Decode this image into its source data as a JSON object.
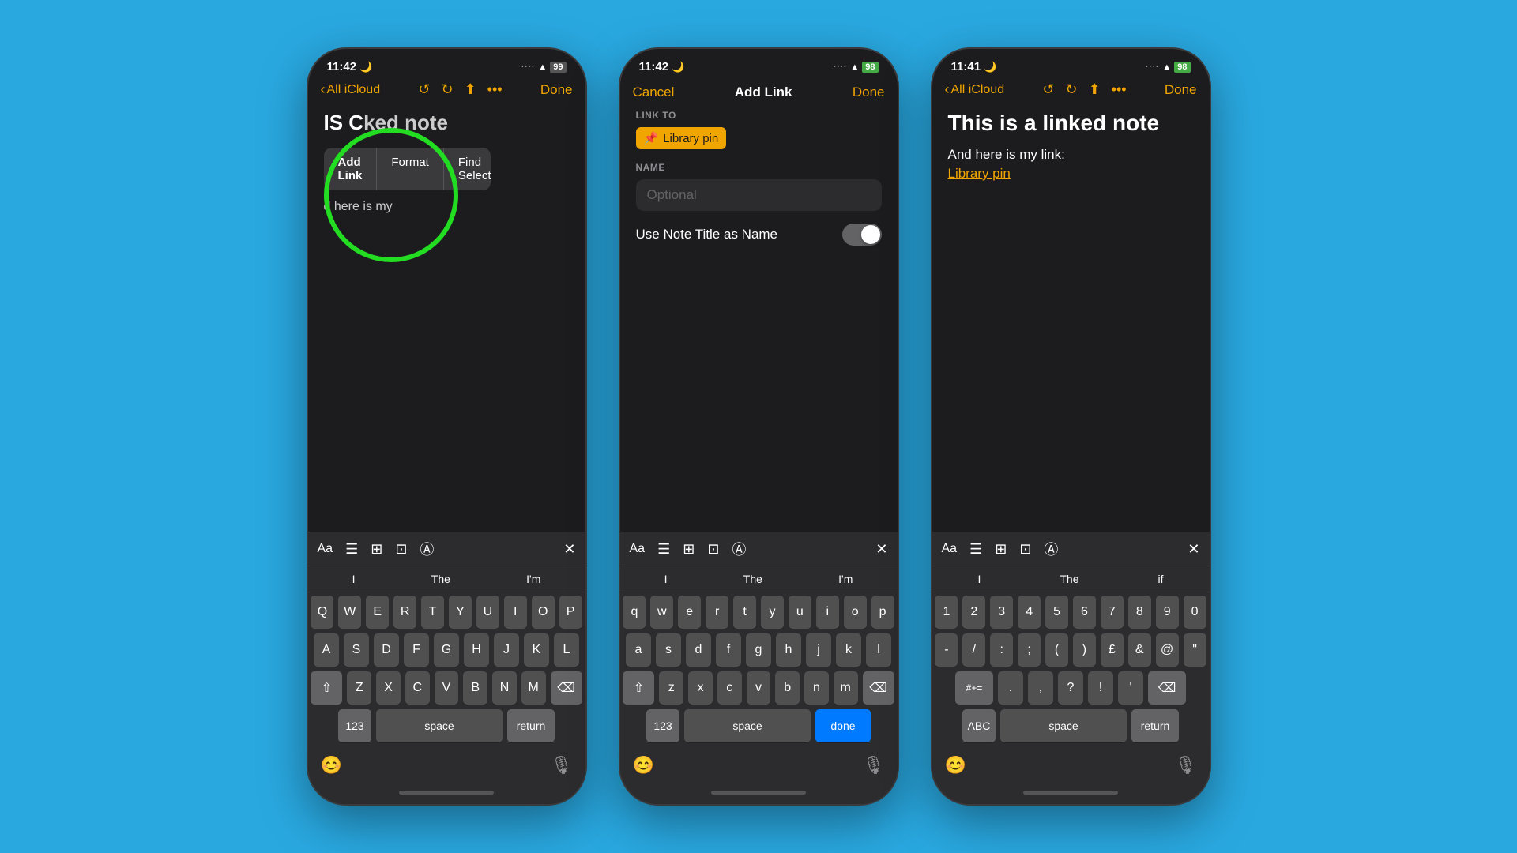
{
  "bg_color": "#29a8e0",
  "phone1": {
    "time": "11:42",
    "moon": "🌙",
    "nav": {
      "back_label": "All iCloud",
      "done_label": "Done"
    },
    "note_title": "IS C",
    "note_subtitle": "ked note",
    "note_body": "d here is my",
    "context_menu": [
      "Add Link",
      "Format",
      "Find Selection"
    ],
    "keyboard": {
      "suggestions": [
        "I",
        "The",
        "I'm"
      ],
      "rows": [
        [
          "Q",
          "W",
          "E",
          "R",
          "T",
          "Y",
          "U",
          "I",
          "O",
          "P"
        ],
        [
          "A",
          "S",
          "D",
          "F",
          "G",
          "H",
          "J",
          "K",
          "L"
        ],
        [
          "Z",
          "X",
          "C",
          "V",
          "B",
          "N",
          "M"
        ],
        [
          "123",
          "space",
          "return"
        ]
      ]
    }
  },
  "phone2": {
    "time": "11:42",
    "moon": "🌙",
    "dialog_title": "Add Link",
    "cancel_label": "Cancel",
    "done_label": "Done",
    "link_to_label": "LINK TO",
    "link_chip": "Library pin",
    "name_label": "NAME",
    "name_placeholder": "Optional",
    "toggle_label": "Use Note Title as Name",
    "keyboard": {
      "suggestions": [
        "I",
        "The",
        "I'm"
      ],
      "done_key": "done",
      "rows": [
        [
          "q",
          "w",
          "e",
          "r",
          "t",
          "y",
          "u",
          "i",
          "o",
          "p"
        ],
        [
          "a",
          "s",
          "d",
          "f",
          "g",
          "h",
          "j",
          "k",
          "l"
        ],
        [
          "z",
          "x",
          "c",
          "v",
          "b",
          "n",
          "m"
        ],
        [
          "123",
          "space",
          "done"
        ]
      ]
    }
  },
  "phone3": {
    "time": "11:41",
    "moon": "🌙",
    "nav": {
      "back_label": "All iCloud",
      "done_label": "Done"
    },
    "note_title": "This is a linked note",
    "note_body": "And here is my link:",
    "note_link": "Library pin",
    "keyboard": {
      "suggestions": [
        "I",
        "The",
        "if"
      ],
      "rows_num": [
        [
          "1",
          "2",
          "3",
          "4",
          "5",
          "6",
          "7",
          "8",
          "9",
          "0"
        ],
        [
          "-",
          "/",
          ":",
          ";",
          "(",
          ")",
          "£",
          "&",
          "@",
          "\""
        ],
        [
          "#+=",
          ".",
          "!",
          "?",
          "'",
          "⌫"
        ],
        [
          "ABC",
          "space",
          "return"
        ]
      ]
    }
  },
  "icons": {
    "bookmark": "⊙",
    "list": "☰",
    "grid": "⊞",
    "camera": "⊡",
    "pen": "Ⓐ",
    "close": "✕",
    "shift": "⇧",
    "delete": "⌫",
    "mic": "🎙",
    "emoji": "😊",
    "share": "↑",
    "more": "···",
    "back": "‹",
    "pin": "📌",
    "signal": "····",
    "wifi": "WiFi",
    "battery99": "99",
    "battery98": "98"
  }
}
